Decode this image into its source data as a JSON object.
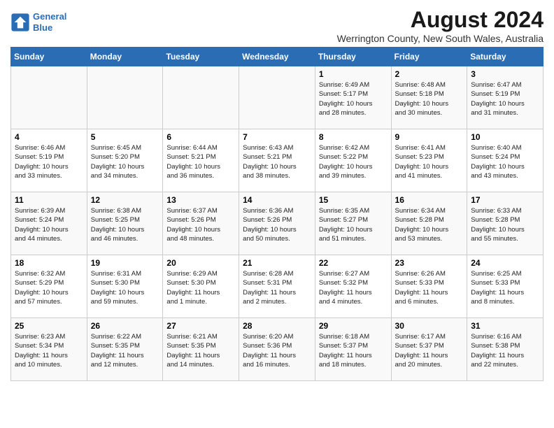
{
  "logo": {
    "line1": "General",
    "line2": "Blue"
  },
  "title": "August 2024",
  "subtitle": "Werrington County, New South Wales, Australia",
  "days_of_week": [
    "Sunday",
    "Monday",
    "Tuesday",
    "Wednesday",
    "Thursday",
    "Friday",
    "Saturday"
  ],
  "weeks": [
    {
      "days": [
        {
          "num": "",
          "info": ""
        },
        {
          "num": "",
          "info": ""
        },
        {
          "num": "",
          "info": ""
        },
        {
          "num": "",
          "info": ""
        },
        {
          "num": "1",
          "info": "Sunrise: 6:49 AM\nSunset: 5:17 PM\nDaylight: 10 hours\nand 28 minutes."
        },
        {
          "num": "2",
          "info": "Sunrise: 6:48 AM\nSunset: 5:18 PM\nDaylight: 10 hours\nand 30 minutes."
        },
        {
          "num": "3",
          "info": "Sunrise: 6:47 AM\nSunset: 5:19 PM\nDaylight: 10 hours\nand 31 minutes."
        }
      ]
    },
    {
      "days": [
        {
          "num": "4",
          "info": "Sunrise: 6:46 AM\nSunset: 5:19 PM\nDaylight: 10 hours\nand 33 minutes."
        },
        {
          "num": "5",
          "info": "Sunrise: 6:45 AM\nSunset: 5:20 PM\nDaylight: 10 hours\nand 34 minutes."
        },
        {
          "num": "6",
          "info": "Sunrise: 6:44 AM\nSunset: 5:21 PM\nDaylight: 10 hours\nand 36 minutes."
        },
        {
          "num": "7",
          "info": "Sunrise: 6:43 AM\nSunset: 5:21 PM\nDaylight: 10 hours\nand 38 minutes."
        },
        {
          "num": "8",
          "info": "Sunrise: 6:42 AM\nSunset: 5:22 PM\nDaylight: 10 hours\nand 39 minutes."
        },
        {
          "num": "9",
          "info": "Sunrise: 6:41 AM\nSunset: 5:23 PM\nDaylight: 10 hours\nand 41 minutes."
        },
        {
          "num": "10",
          "info": "Sunrise: 6:40 AM\nSunset: 5:24 PM\nDaylight: 10 hours\nand 43 minutes."
        }
      ]
    },
    {
      "days": [
        {
          "num": "11",
          "info": "Sunrise: 6:39 AM\nSunset: 5:24 PM\nDaylight: 10 hours\nand 44 minutes."
        },
        {
          "num": "12",
          "info": "Sunrise: 6:38 AM\nSunset: 5:25 PM\nDaylight: 10 hours\nand 46 minutes."
        },
        {
          "num": "13",
          "info": "Sunrise: 6:37 AM\nSunset: 5:26 PM\nDaylight: 10 hours\nand 48 minutes."
        },
        {
          "num": "14",
          "info": "Sunrise: 6:36 AM\nSunset: 5:26 PM\nDaylight: 10 hours\nand 50 minutes."
        },
        {
          "num": "15",
          "info": "Sunrise: 6:35 AM\nSunset: 5:27 PM\nDaylight: 10 hours\nand 51 minutes."
        },
        {
          "num": "16",
          "info": "Sunrise: 6:34 AM\nSunset: 5:28 PM\nDaylight: 10 hours\nand 53 minutes."
        },
        {
          "num": "17",
          "info": "Sunrise: 6:33 AM\nSunset: 5:28 PM\nDaylight: 10 hours\nand 55 minutes."
        }
      ]
    },
    {
      "days": [
        {
          "num": "18",
          "info": "Sunrise: 6:32 AM\nSunset: 5:29 PM\nDaylight: 10 hours\nand 57 minutes."
        },
        {
          "num": "19",
          "info": "Sunrise: 6:31 AM\nSunset: 5:30 PM\nDaylight: 10 hours\nand 59 minutes."
        },
        {
          "num": "20",
          "info": "Sunrise: 6:29 AM\nSunset: 5:30 PM\nDaylight: 11 hours\nand 1 minute."
        },
        {
          "num": "21",
          "info": "Sunrise: 6:28 AM\nSunset: 5:31 PM\nDaylight: 11 hours\nand 2 minutes."
        },
        {
          "num": "22",
          "info": "Sunrise: 6:27 AM\nSunset: 5:32 PM\nDaylight: 11 hours\nand 4 minutes."
        },
        {
          "num": "23",
          "info": "Sunrise: 6:26 AM\nSunset: 5:33 PM\nDaylight: 11 hours\nand 6 minutes."
        },
        {
          "num": "24",
          "info": "Sunrise: 6:25 AM\nSunset: 5:33 PM\nDaylight: 11 hours\nand 8 minutes."
        }
      ]
    },
    {
      "days": [
        {
          "num": "25",
          "info": "Sunrise: 6:23 AM\nSunset: 5:34 PM\nDaylight: 11 hours\nand 10 minutes."
        },
        {
          "num": "26",
          "info": "Sunrise: 6:22 AM\nSunset: 5:35 PM\nDaylight: 11 hours\nand 12 minutes."
        },
        {
          "num": "27",
          "info": "Sunrise: 6:21 AM\nSunset: 5:35 PM\nDaylight: 11 hours\nand 14 minutes."
        },
        {
          "num": "28",
          "info": "Sunrise: 6:20 AM\nSunset: 5:36 PM\nDaylight: 11 hours\nand 16 minutes."
        },
        {
          "num": "29",
          "info": "Sunrise: 6:18 AM\nSunset: 5:37 PM\nDaylight: 11 hours\nand 18 minutes."
        },
        {
          "num": "30",
          "info": "Sunrise: 6:17 AM\nSunset: 5:37 PM\nDaylight: 11 hours\nand 20 minutes."
        },
        {
          "num": "31",
          "info": "Sunrise: 6:16 AM\nSunset: 5:38 PM\nDaylight: 11 hours\nand 22 minutes."
        }
      ]
    }
  ]
}
